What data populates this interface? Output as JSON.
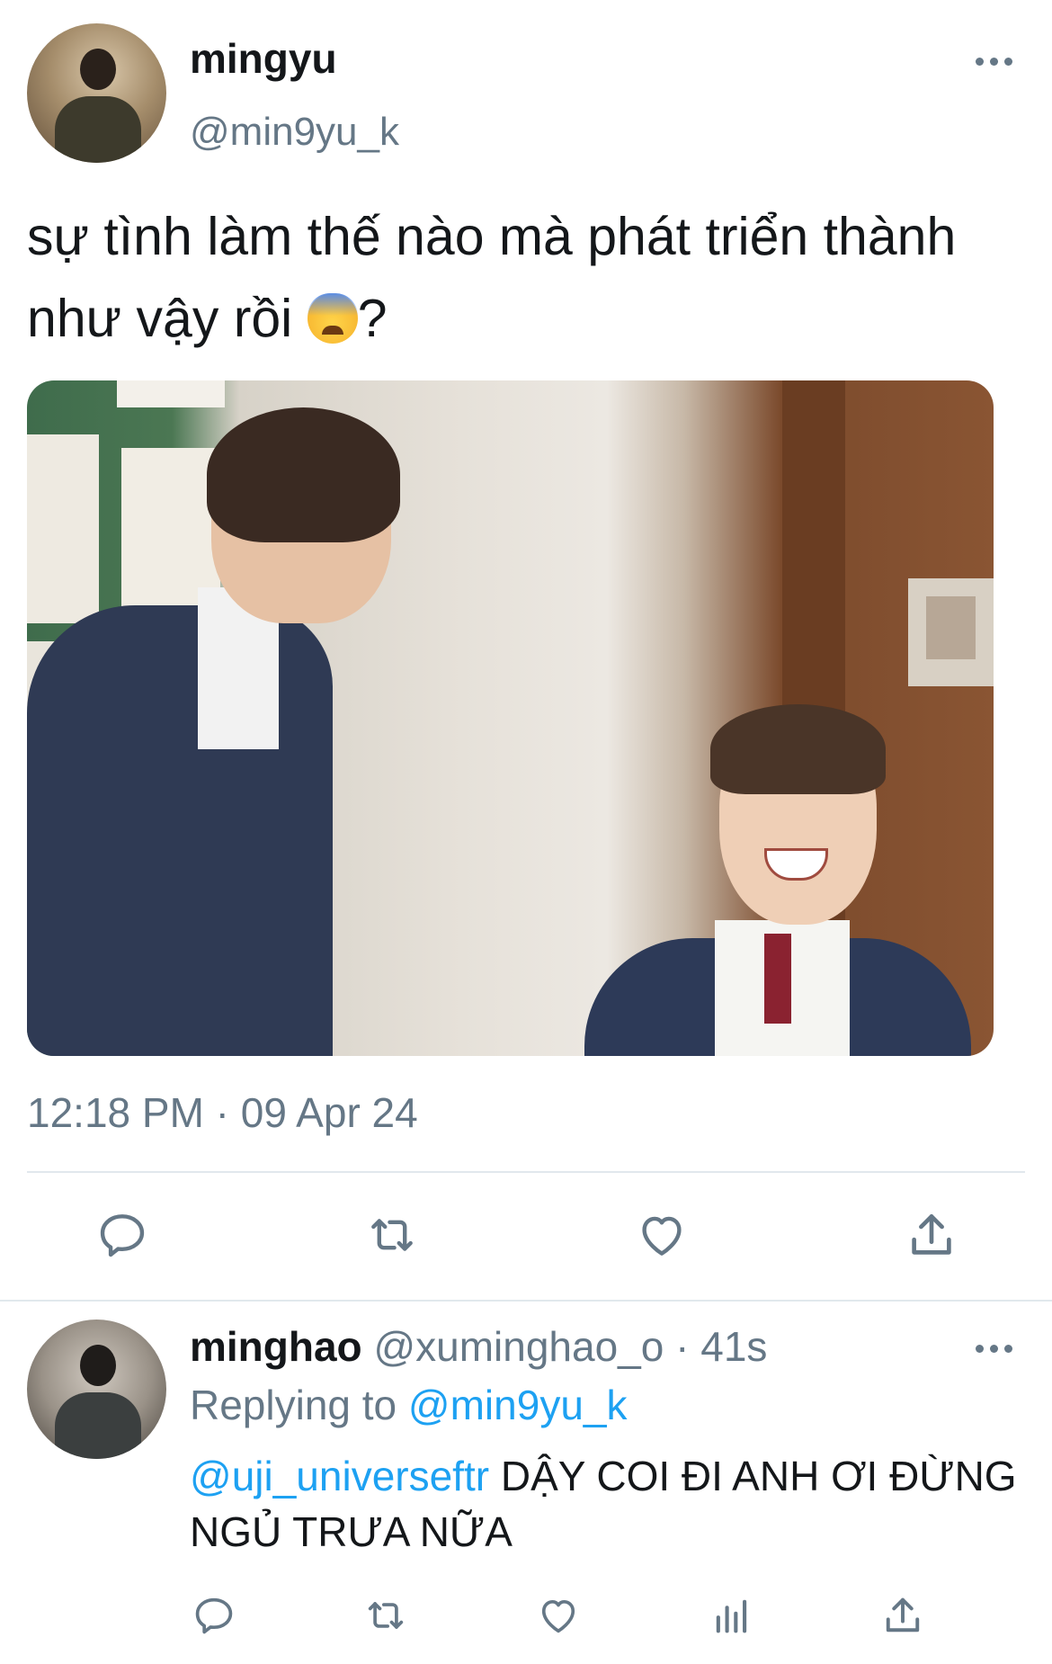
{
  "main_tweet": {
    "display_name": "mingyu",
    "handle": "@min9yu_k",
    "text": "sự tình làm thế nào mà phát triển thành như vậy rồi",
    "text_suffix": "?",
    "emoji": "anxious-face-with-sweat",
    "photo_alt": "two students in navy school blazers in a classroom",
    "timestamp": "12:18 PM · 09 Apr 24",
    "actions": [
      "reply-icon",
      "retweet-icon",
      "like-icon",
      "share-icon"
    ]
  },
  "reply": {
    "display_name": "minghao",
    "handle": "@xuminghao_o",
    "separator": "·",
    "age": "41s",
    "replying_to_label": "Replying to",
    "replying_to_handle": "@min9yu_k",
    "mention": "@uji_universeftr",
    "text": "DẬY COI ĐI ANH ƠI ĐỪNG NGỦ TRƯA NỮA",
    "actions": [
      "reply-icon",
      "retweet-icon",
      "like-icon",
      "analytics-icon",
      "share-icon"
    ]
  },
  "colors": {
    "text": "#14171a",
    "secondary": "#657786",
    "link": "#1da1f2",
    "divider": "#e1e8ed"
  }
}
